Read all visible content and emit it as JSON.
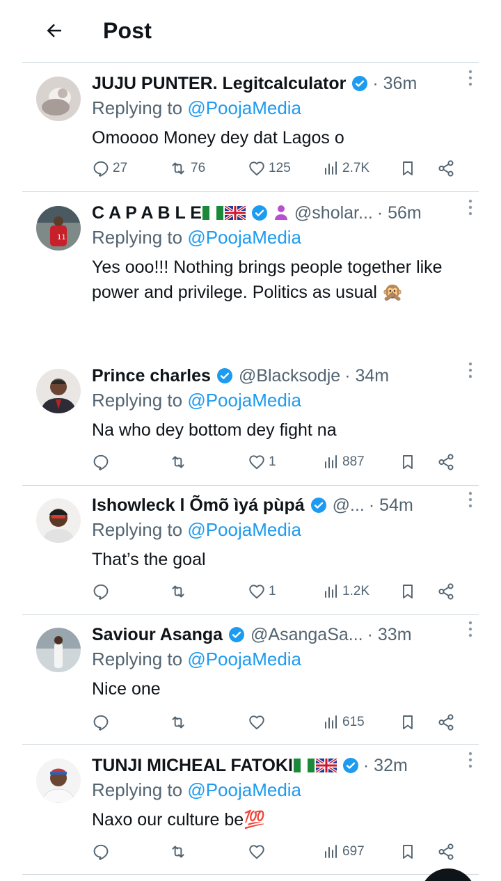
{
  "header": {
    "title": "Post"
  },
  "tweets": [
    {
      "name": "JUJU PUNTER. Legitcalculator",
      "handle": "",
      "time": "· 36m",
      "replying_prefix": "Replying to ",
      "replying_to": "@PoojaMedia",
      "text": "Omoooo Money dey dat Lagos o",
      "replies": "27",
      "reposts": "76",
      "likes": "125",
      "views": "2.7K"
    },
    {
      "name": "C A P A B L E",
      "handle": "@sholar...",
      "time": "· 56m",
      "replying_prefix": "Replying to ",
      "replying_to": "@PoojaMedia",
      "text": "Yes ooo!!! Nothing brings people together like power and privilege. Politics as usual 🙊",
      "replies": "",
      "reposts": "",
      "likes": "",
      "views": ""
    },
    {
      "name": "Prince charles",
      "handle": "@Blacksodje",
      "time": "· 34m",
      "replying_prefix": "Replying to ",
      "replying_to": "@PoojaMedia",
      "text": "Na who dey bottom dey fight na",
      "replies": "",
      "reposts": "",
      "likes": "1",
      "views": "887"
    },
    {
      "name": "Ishowleck l Õmõ ìyá pùpá",
      "handle": "@...",
      "time": "· 54m",
      "replying_prefix": "Replying to ",
      "replying_to": "@PoojaMedia",
      "text": "That’s the goal",
      "replies": "",
      "reposts": "",
      "likes": "1",
      "views": "1.2K"
    },
    {
      "name": "Saviour Asanga",
      "handle": "@AsangaSa...",
      "time": "· 33m",
      "replying_prefix": "Replying to ",
      "replying_to": "@PoojaMedia",
      "text": "Nice one",
      "replies": "",
      "reposts": "",
      "likes": "",
      "views": "615"
    },
    {
      "name": "TUNJI MICHEAL FATOKI",
      "handle": "",
      "time": "· 32m",
      "replying_prefix": "Replying to ",
      "replying_to": "@PoojaMedia",
      "text": "Naxo our culture be💯",
      "replies": "",
      "reposts": "",
      "likes": "",
      "views": "697"
    }
  ],
  "colors": {
    "text": "#0f1419",
    "secondary": "#536471",
    "accent": "#1d9bf0",
    "divider": "#cfd9de"
  },
  "icons": [
    "back-arrow-icon",
    "verified-badge-icon",
    "more-icon",
    "reply-icon",
    "repost-icon",
    "like-icon",
    "views-icon",
    "bookmark-icon",
    "share-icon",
    "nigeria-flag-icon",
    "uk-flag-icon"
  ]
}
